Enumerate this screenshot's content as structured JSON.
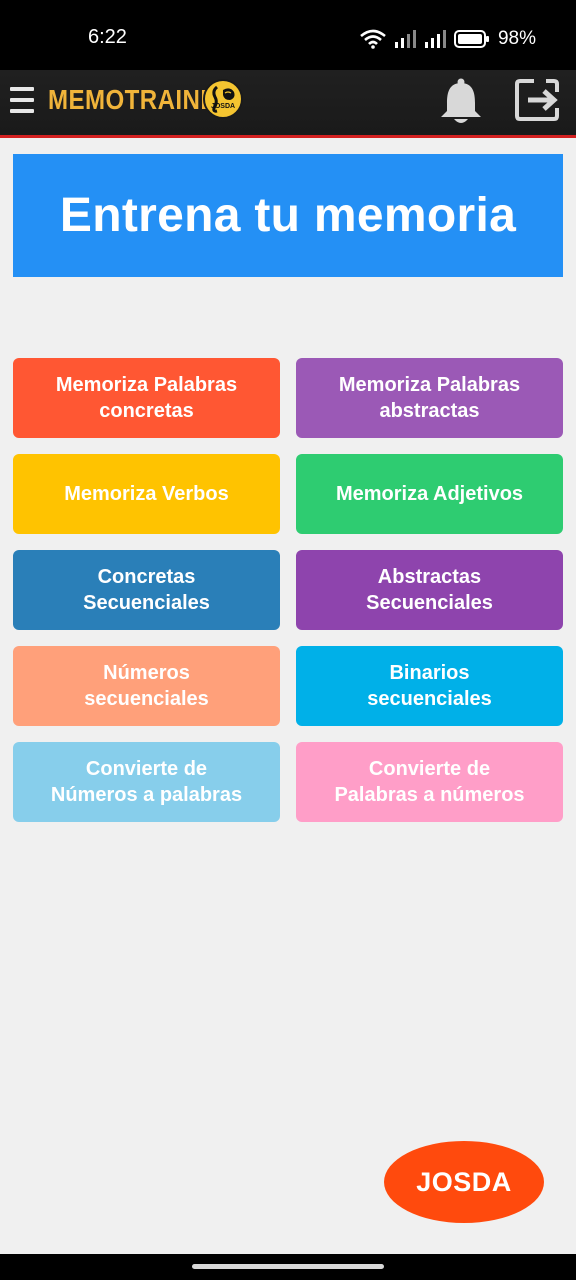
{
  "status_bar": {
    "time": "6:22",
    "battery": "98%",
    "icons": [
      "wifi-icon",
      "signal-icon",
      "signal-icon",
      "battery-icon"
    ]
  },
  "app_bar": {
    "brand_title": "MEMOTRAINER",
    "logo_text": "JOSDA",
    "icons": [
      "menu-icon",
      "bell-icon",
      "logout-icon"
    ]
  },
  "banner": {
    "title": "Entrena tu memoria"
  },
  "tiles": [
    {
      "label": "Memoriza Palabras\nconcretas",
      "color": "#ff5733"
    },
    {
      "label": "Memoriza Palabras\nabstractas",
      "color": "#9b59b6"
    },
    {
      "label": "Memoriza Verbos",
      "color": "#ffc300"
    },
    {
      "label": "Memoriza Adjetivos",
      "color": "#2ecc71"
    },
    {
      "label": "Concretas\nSecuenciales",
      "color": "#2a7fb8"
    },
    {
      "label": "Abstractas\nSecuenciales",
      "color": "#8e44ad"
    },
    {
      "label": "Números\nsecuenciales",
      "color": "#ffa07a"
    },
    {
      "label": "Binarios\nsecuenciales",
      "color": "#00b0e8"
    },
    {
      "label": "Convierte de\nNúmeros a palabras",
      "color": "#87ceeb"
    },
    {
      "label": "Convierte de\nPalabras a números",
      "color": "#ff9ec8"
    }
  ],
  "footer": {
    "josda_label": "JOSDA",
    "josda_color": "#ff4a0d"
  },
  "colors": {
    "banner": "#2490f5",
    "brand": "#f0b43a",
    "app_bar_border": "#d32020"
  }
}
